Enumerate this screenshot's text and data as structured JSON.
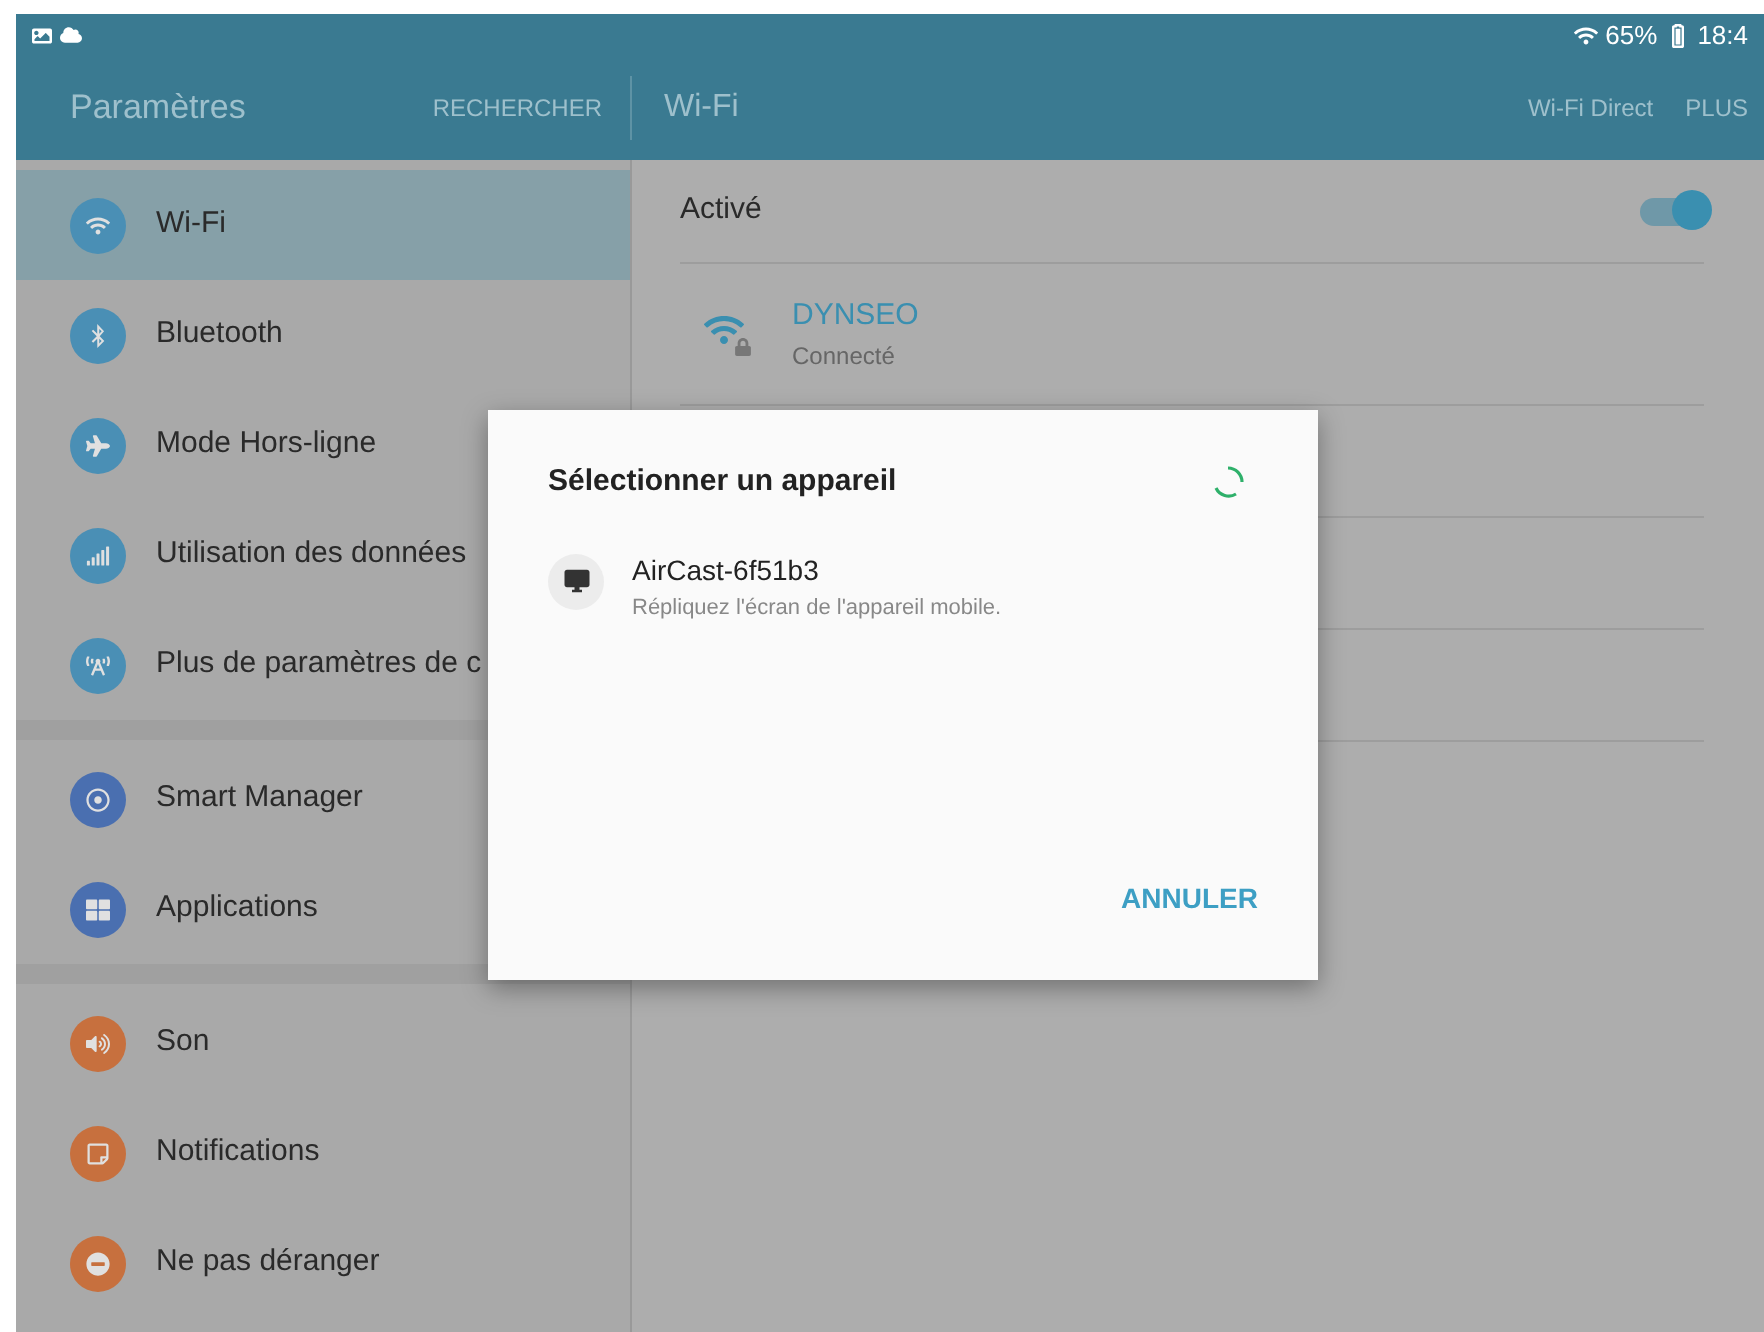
{
  "status_bar": {
    "battery": "65%",
    "time": "18:4"
  },
  "app_bar": {
    "title": "Paramètres",
    "search": "RECHERCHER",
    "section": "Wi-Fi",
    "actions": [
      "Wi-Fi Direct",
      "PLUS"
    ]
  },
  "sidebar": {
    "groups": [
      {
        "items": [
          {
            "label": "Wi-Fi",
            "color": "#4a8fb5",
            "selected": true
          },
          {
            "label": "Bluetooth",
            "color": "#4a8fb5",
            "selected": false
          },
          {
            "label": "Mode Hors-ligne",
            "color": "#4a8fb5",
            "selected": false
          },
          {
            "label": "Utilisation des données",
            "color": "#4a8fb5",
            "selected": false
          },
          {
            "label": "Plus de paramètres de c",
            "color": "#4a8fb5",
            "selected": false
          }
        ]
      },
      {
        "items": [
          {
            "label": "Smart Manager",
            "color": "#4a6fb0",
            "selected": false
          },
          {
            "label": "Applications",
            "color": "#4a6fb0",
            "selected": false
          }
        ]
      },
      {
        "items": [
          {
            "label": "Son",
            "color": "#c7703e",
            "selected": false
          },
          {
            "label": "Notifications",
            "color": "#c7703e",
            "selected": false
          },
          {
            "label": "Ne pas déranger",
            "color": "#c7703e",
            "selected": false
          }
        ]
      }
    ]
  },
  "wifi": {
    "label": "Activé",
    "on": true,
    "networks": [
      {
        "name": "DYNSEO",
        "status": "Connecté"
      }
    ]
  },
  "dialog": {
    "title": "Sélectionner un appareil",
    "devices": [
      {
        "name": "AirCast-6f51b3",
        "description": "Répliquez l'écran de l'appareil mobile."
      }
    ],
    "button": "ANNULER"
  }
}
